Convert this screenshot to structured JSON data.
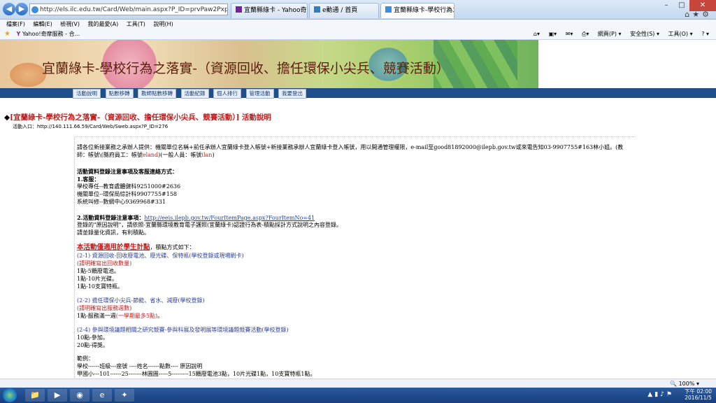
{
  "browser": {
    "address": "http://els.ilc.edu.tw/Card/Web/main.aspx?P_ID=prvPaw2Pxp5SqjkH5",
    "tabs": [
      {
        "label": "宜蘭縣綠卡 - Yahoo奇摩 搜尋...",
        "active": false
      },
      {
        "label": "e動通 / 首頁",
        "active": false
      },
      {
        "label": "宜蘭縣綠卡-學校行為之落...",
        "active": true
      }
    ],
    "menu": [
      "檔案(F)",
      "編輯(E)",
      "檢視(V)",
      "我的最愛(A)",
      "工具(T)",
      "說明(H)"
    ],
    "favorites_item": "Yahoo!奇摩服務 - 合...",
    "command_bar": [
      "網頁(P) ▾",
      "安全性(S) ▾",
      "工具(O) ▾",
      "? ▾"
    ],
    "zoom": "100%"
  },
  "page": {
    "banner_title": "宜蘭綠卡-學校行為之落實-（資源回收、擔任環保小尖兵、競賽活動）",
    "nav": [
      "活動說明",
      "點數移轉",
      "教師點數移轉",
      "活動紀錄",
      "個人排行",
      "管理活動",
      "我要登出"
    ],
    "headline_main": "宜蘭綠卡-學校行為之落實-（資源回收、擔任環保小尖兵、競賽活動）",
    "headline_suffix": "活動說明",
    "entry": "活動入口：http://140.111.66.59/Card/Web/Sweb.aspx?P_ID=276",
    "intro_1": "請各位新接業務之承辦人提供：機關單位名稱+前任承辦人宜蘭綠卡登入帳號+新接業務承辦人宜蘭綠卡登入帳號，用以開通管理權限，e-mail至good81892000@ilepb.gov.tw或來電告知03-9907755#163林小姐。(教",
    "intro_2a": "師：帳號\\(縣府員工：帳號",
    "intro_2b": "eland",
    "intro_2c": ")(一般人員：帳號",
    "intro_2d": "ilan",
    "intro_2e": ")",
    "contact_title": "活動資料登錄注意事項及客服連絡方式：",
    "service_title": "1.客服：",
    "service": [
      "學校專任--教育處體健科9251000#2636",
      "機關單位--環保局綜計科9907755#158",
      "系統叫修--數網中心9369968#331"
    ],
    "reg_title": "2.活動資料登錄注意事項：",
    "reg_link": "http://eeis.ilepb.gov.tw/FourItemPage.aspx?FourItemNo=41",
    "reg_1": "登錄的\"原因說明\"，請依照-宜蘭縣環境教育電子護照(宜蘭綠卡)認證行為表-積點採計方式說明之內容登錄。",
    "reg_2": "請並錄量化資訊，有利積點。",
    "scope_red": "本活動僅適用於學生計點",
    "scope_rest": "，積點方式如下：",
    "s1_title": "(2-1) 資源回收-回收廢電池、廢光碟、保特瓶",
    "s1_note": "(學校登錄或現場刷卡)",
    "s1_red": "(請明確寫出回收數量)",
    "s1_items": [
      "1點-5顆廢電池。",
      "1點-10片光碟。",
      "1點-10支寶特瓶。"
    ],
    "s2_title": "(2-2) 擔任環保小尖兵-節能、省水、減廢",
    "s2_note": "(學校登錄)",
    "s2_red": "(請明確寫出服務週數)",
    "s2_item_a": "1點-服務滿一週",
    "s2_item_b": "(一學期最多5點)",
    "s2_item_c": "。",
    "s4_title": "(2-4) 參與環境議題相關之研究競賽-參與科展及發明展等環境議題競賽活動",
    "s4_note": "(學校登錄)",
    "s4_items": [
      "10點-參加。",
      "20點-得獎。"
    ],
    "example_title": "範例：",
    "example_1": "學校------班級---座號 ----姓名------點數---- 原因說明",
    "example_2": "甲國小---101------25-------林圓圓-----5---------15顆廢電池3點，10片光碟1點，10支寶特瓶1點。"
  },
  "taskbar": {
    "clock_time": "下午 02:00",
    "clock_date": "2016/11/5"
  }
}
